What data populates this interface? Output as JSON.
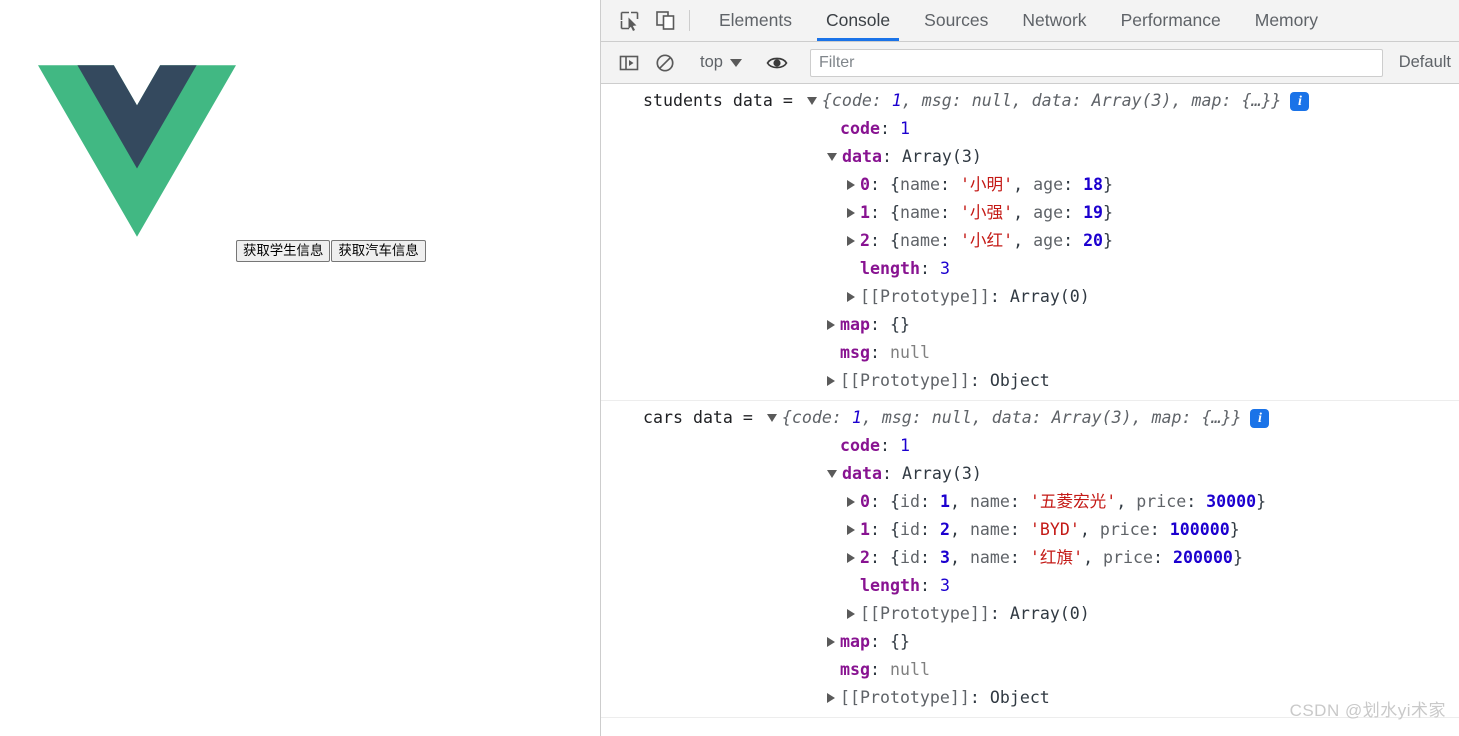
{
  "page": {
    "logo": {
      "name": "vue-logo",
      "green": "#42b883",
      "navy": "#35495e"
    },
    "buttons": [
      {
        "name": "get-students-button",
        "label": "获取学生信息"
      },
      {
        "name": "get-cars-button",
        "label": "获取汽车信息"
      }
    ]
  },
  "devtools": {
    "toolbar": {
      "inspect_icon": "inspect-element-icon",
      "device_icon": "device-toolbar-icon",
      "tabs": [
        {
          "label": "Elements",
          "active": false
        },
        {
          "label": "Console",
          "active": true
        },
        {
          "label": "Sources",
          "active": false
        },
        {
          "label": "Network",
          "active": false
        },
        {
          "label": "Performance",
          "active": false
        },
        {
          "label": "Memory",
          "active": false
        }
      ],
      "active_tab": "Console",
      "active_underline_color": "#1a73e8"
    },
    "filterbar": {
      "sidebar_icon": "console-sidebar-icon",
      "clear_icon": "clear-console-icon",
      "context": "top",
      "eye_icon": "live-expression-icon",
      "filter_placeholder": "Filter",
      "filter_value": "",
      "level": "Default"
    },
    "console": {
      "entries": [
        {
          "label": "students data =",
          "preview": "{code: 1, msg: null, data: Array(3), map: {…}}",
          "info_badge": "i",
          "rows": [
            {
              "indent": 1,
              "arrow": "none",
              "key": "code",
              "key_style": "prop",
              "sep": ": ",
              "value": "1",
              "value_style": "num"
            },
            {
              "indent": 1,
              "arrow": "open",
              "key": "data",
              "key_style": "prop",
              "sep": ": ",
              "value": "Array(3)",
              "value_style": "txt"
            },
            {
              "indent": 2,
              "arrow": "closed",
              "key": "0",
              "key_style": "prop",
              "sep": ": ",
              "value": "{name: '小明', age: 18}",
              "value_style": "objname"
            },
            {
              "indent": 2,
              "arrow": "closed",
              "key": "1",
              "key_style": "prop",
              "sep": ": ",
              "value": "{name: '小强', age: 19}",
              "value_style": "objname"
            },
            {
              "indent": 2,
              "arrow": "closed",
              "key": "2",
              "key_style": "prop",
              "sep": ": ",
              "value": "{name: '小红', age: 20}",
              "value_style": "objname"
            },
            {
              "indent": 2,
              "arrow": "none",
              "key": "length",
              "key_style": "prop",
              "sep": ": ",
              "value": "3",
              "value_style": "num"
            },
            {
              "indent": 2,
              "arrow": "closed",
              "key": "[[Prototype]]",
              "key_style": "proto",
              "sep": ": ",
              "value": "Array(0)",
              "value_style": "txt"
            },
            {
              "indent": 1,
              "arrow": "closed",
              "key": "map",
              "key_style": "prop",
              "sep": ": ",
              "value": "{}",
              "value_style": "txt"
            },
            {
              "indent": 1,
              "arrow": "none",
              "key": "msg",
              "key_style": "prop",
              "sep": ": ",
              "value": "null",
              "value_style": "null"
            },
            {
              "indent": 1,
              "arrow": "closed",
              "key": "[[Prototype]]",
              "key_style": "proto",
              "sep": ": ",
              "value": "Object",
              "value_style": "txt"
            }
          ]
        },
        {
          "label": "cars data =",
          "preview": "{code: 1, msg: null, data: Array(3), map: {…}}",
          "info_badge": "i",
          "rows": [
            {
              "indent": 1,
              "arrow": "none",
              "key": "code",
              "key_style": "prop",
              "sep": ": ",
              "value": "1",
              "value_style": "num"
            },
            {
              "indent": 1,
              "arrow": "open",
              "key": "data",
              "key_style": "prop",
              "sep": ": ",
              "value": "Array(3)",
              "value_style": "txt"
            },
            {
              "indent": 2,
              "arrow": "closed",
              "key": "0",
              "key_style": "prop",
              "sep": ": ",
              "value": "{id: 1, name: '五菱宏光', price: 30000}",
              "value_style": "carobj"
            },
            {
              "indent": 2,
              "arrow": "closed",
              "key": "1",
              "key_style": "prop",
              "sep": ": ",
              "value": "{id: 2, name: 'BYD', price: 100000}",
              "value_style": "carobj"
            },
            {
              "indent": 2,
              "arrow": "closed",
              "key": "2",
              "key_style": "prop",
              "sep": ": ",
              "value": "{id: 3, name: '红旗', price: 200000}",
              "value_style": "carobj"
            },
            {
              "indent": 2,
              "arrow": "none",
              "key": "length",
              "key_style": "prop",
              "sep": ": ",
              "value": "3",
              "value_style": "num"
            },
            {
              "indent": 2,
              "arrow": "closed",
              "key": "[[Prototype]]",
              "key_style": "proto",
              "sep": ": ",
              "value": "Array(0)",
              "value_style": "txt"
            },
            {
              "indent": 1,
              "arrow": "closed",
              "key": "map",
              "key_style": "prop",
              "sep": ": ",
              "value": "{}",
              "value_style": "txt"
            },
            {
              "indent": 1,
              "arrow": "none",
              "key": "msg",
              "key_style": "prop",
              "sep": ": ",
              "value": "null",
              "value_style": "null"
            },
            {
              "indent": 1,
              "arrow": "closed",
              "key": "[[Prototype]]",
              "key_style": "proto",
              "sep": ": ",
              "value": "Object",
              "value_style": "txt"
            }
          ]
        }
      ]
    }
  },
  "watermark": "CSDN @划水yi术家"
}
